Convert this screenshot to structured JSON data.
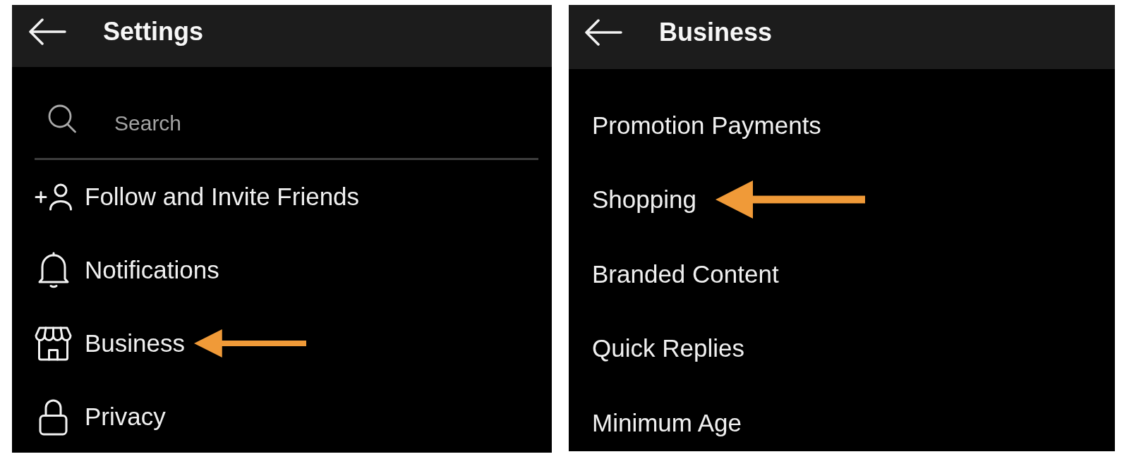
{
  "screens": [
    {
      "kind": "icons",
      "header": {
        "title": "Settings"
      },
      "search": {
        "placeholder": "Search"
      },
      "items": [
        {
          "label": "Follow and Invite Friends",
          "pointed_at": false
        },
        {
          "label": "Notifications",
          "pointed_at": false
        },
        {
          "label": "Business",
          "pointed_at": true
        },
        {
          "label": "Privacy",
          "pointed_at": false
        }
      ]
    },
    {
      "kind": "plain",
      "header": {
        "title": "Business"
      },
      "items": [
        {
          "label": "Promotion Payments",
          "pointed_at": false
        },
        {
          "label": "Shopping",
          "pointed_at": true
        },
        {
          "label": "Branded Content",
          "pointed_at": false
        },
        {
          "label": "Quick Replies",
          "pointed_at": false
        },
        {
          "label": "Minimum Age",
          "pointed_at": false
        }
      ]
    }
  ]
}
